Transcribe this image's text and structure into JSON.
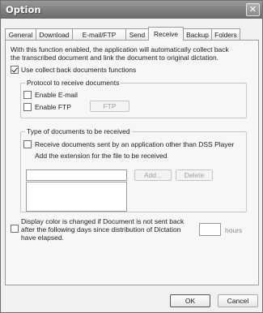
{
  "window": {
    "title": "Option",
    "close_glyph": "✕"
  },
  "tabs": [
    {
      "label": "General"
    },
    {
      "label": "Download"
    },
    {
      "label": "E-mail/FTP"
    },
    {
      "label": "Send"
    },
    {
      "label": "Receive",
      "active": true
    },
    {
      "label": "Backup"
    },
    {
      "label": "Folders"
    }
  ],
  "receive": {
    "description_line1": "With this function enabled, the application will automatically collect back",
    "description_line2": "the transcribed document and link the document to original dictation.",
    "use_collect_back_label": "Use collect back documents functions",
    "use_collect_back_checked": true,
    "protocol": {
      "legend": "Protocol to receive documents",
      "email_label": "Enable E-mail",
      "email_checked": false,
      "ftp_label": "Enable FTP",
      "ftp_checked": false,
      "ftp_button": "FTP"
    },
    "doc_types": {
      "legend": "Type of documents to be received",
      "other_app_label": "Receive documents sent by an application other than DSS Player",
      "other_app_checked": false,
      "extension_hint": "Add the extension for the file to be received",
      "extension_value": "",
      "add_button": "Add...",
      "delete_button": "Delete",
      "extensions": []
    },
    "display_color": {
      "checked": false,
      "line1": "Display color is changed if Document is not sent back",
      "line2": "after the following days since distribution of Dictation",
      "line3": "have elapsed.",
      "days_value": "",
      "unit": "hours"
    }
  },
  "footer": {
    "ok_label": "OK",
    "cancel_label": "Cancel"
  }
}
